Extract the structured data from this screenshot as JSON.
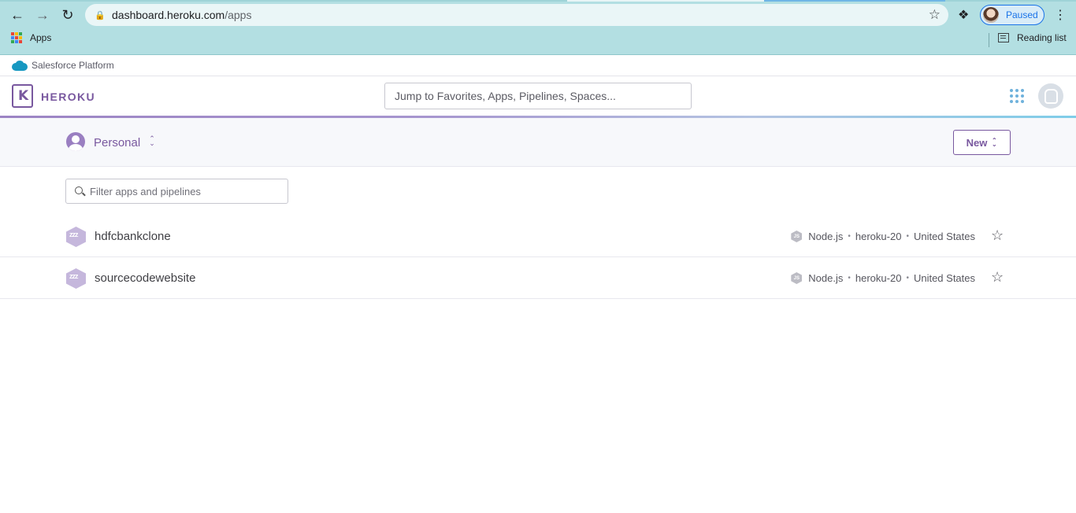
{
  "browser": {
    "url_host": "dashboard.heroku.com",
    "url_path": "/apps",
    "profile_label": "Paused",
    "bookmarks": {
      "apps_label": "Apps",
      "reading_list_label": "Reading list"
    },
    "colors": {
      "toolbar": "#b3dfe2",
      "profile_accent": "#1a73e8"
    }
  },
  "platform_strip": {
    "label": "Salesforce Platform"
  },
  "header": {
    "brand": "HEROKU",
    "logo_glyph": "K",
    "search_placeholder": "Jump to Favorites, Apps, Pipelines, Spaces...",
    "icons": [
      "apps-grid-icon",
      "user-avatar-icon"
    ],
    "brand_color": "#79589f"
  },
  "subheader": {
    "team_name": "Personal",
    "new_button_label": "New"
  },
  "filter": {
    "placeholder": "Filter apps and pipelines"
  },
  "apps": [
    {
      "name": "hdfcbankclone",
      "language": "Node.js",
      "stack": "heroku-20",
      "region": "United States",
      "favorited": false
    },
    {
      "name": "sourcecodewebsite",
      "language": "Node.js",
      "stack": "heroku-20",
      "region": "United States",
      "favorited": false
    }
  ]
}
